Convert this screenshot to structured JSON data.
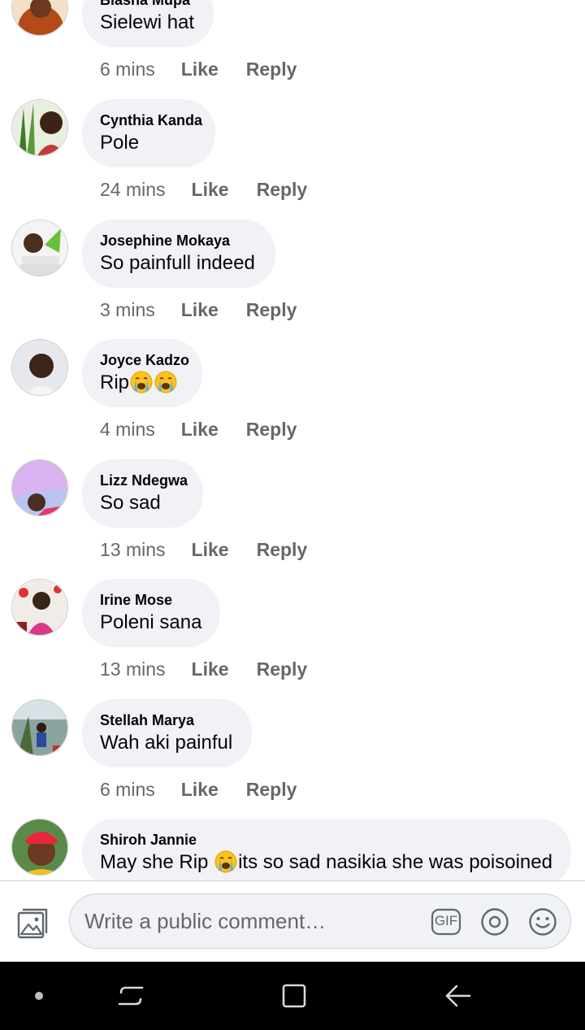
{
  "comments": [
    {
      "name": "Biasha Mupa",
      "text": "Sielewi hat",
      "time": "6 mins",
      "like": "Like",
      "reply": "Reply"
    },
    {
      "name": "Cynthia Kanda",
      "text": "Pole",
      "time": "24 mins",
      "like": "Like",
      "reply": "Reply"
    },
    {
      "name": "Josephine Mokaya",
      "text": "So painfull indeed",
      "time": "3 mins",
      "like": "Like",
      "reply": "Reply"
    },
    {
      "name": "Joyce Kadzo",
      "text": "Rip",
      "time": "4 mins",
      "like": "Like",
      "reply": "Reply"
    },
    {
      "name": "Lizz Ndegwa",
      "text": "So sad",
      "time": "13 mins",
      "like": "Like",
      "reply": "Reply"
    },
    {
      "name": "Irine Mose",
      "text": "Poleni sana",
      "time": "13 mins",
      "like": "Like",
      "reply": "Reply"
    },
    {
      "name": "Stellah Marya",
      "text": "Wah aki painful",
      "time": "6 mins",
      "like": "Like",
      "reply": "Reply"
    },
    {
      "name": "Shiroh Jannie",
      "text_before": "May she Rip ",
      "text_after": "its so sad nasikia she was poisoined"
    }
  ],
  "composer": {
    "placeholder": "Write a public comment…",
    "gif_label": "GIF",
    "icons": [
      "photo-icon",
      "gif-icon",
      "mention-icon",
      "emoji-icon"
    ]
  },
  "navbar": {
    "icons": [
      "dot-icon",
      "recent-apps-icon",
      "home-icon",
      "back-icon"
    ]
  },
  "colors": {
    "bubble": "#f0f2f5",
    "meta_text": "#65676b",
    "name_text": "#050505",
    "navbar": "#000000"
  }
}
